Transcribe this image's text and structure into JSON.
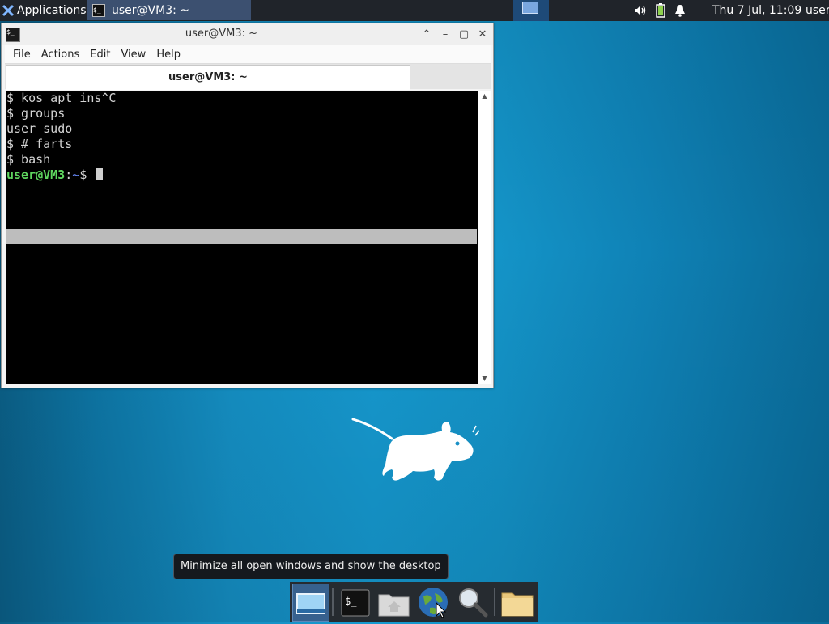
{
  "top_panel": {
    "applications_label": "Applications",
    "task_title": "user@VM3: ~",
    "clock": "Thu  7 Jul, 11:09",
    "user": "user",
    "tray_icons": [
      "volume-icon",
      "battery-icon",
      "notification-bell-icon"
    ]
  },
  "terminal_window": {
    "title": "user@VM3: ~",
    "menu": [
      "File",
      "Actions",
      "Edit",
      "View",
      "Help"
    ],
    "tab_label": "user@VM3: ~",
    "lines": [
      "$ kos apt ins^C",
      "$ groups",
      "user sudo",
      "$ # farts",
      "$ bash"
    ],
    "prompt": {
      "user_host": "user@VM3",
      "colon": ":",
      "path": "~",
      "symbol": "$"
    },
    "colors": {
      "prompt_user": "#5fd75f",
      "prompt_path": "#6a8cff",
      "text": "#d4d4d4",
      "background": "#000000"
    }
  },
  "tooltip": {
    "text": "Minimize all open windows and show the desktop"
  },
  "dock": {
    "items": [
      "show-desktop",
      "terminal",
      "home-folder",
      "web-browser",
      "app-finder",
      "file-manager"
    ]
  },
  "desktop": {
    "accent": "#1592c6"
  }
}
